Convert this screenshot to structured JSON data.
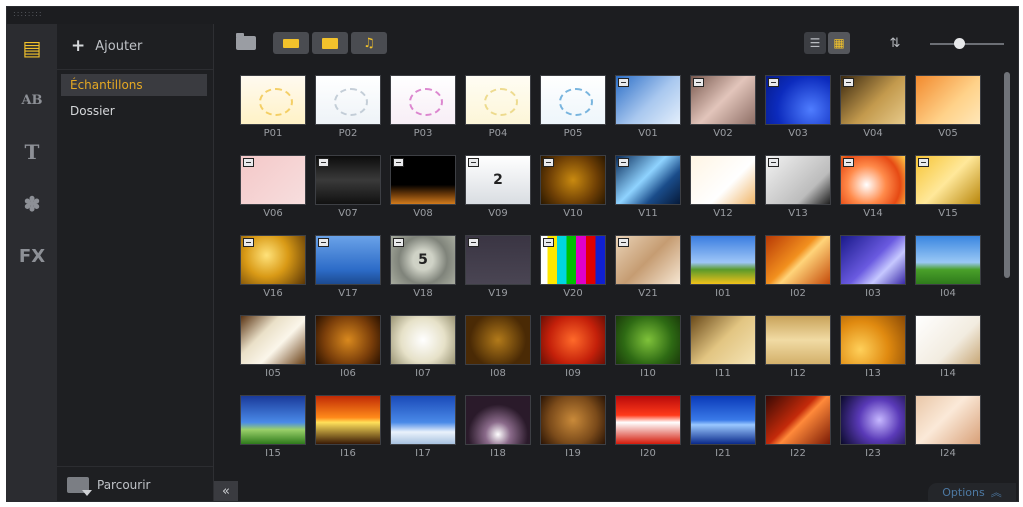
{
  "window": {
    "grip": "::::::::"
  },
  "rail": [
    {
      "name": "media-library-icon",
      "glyph": "▤"
    },
    {
      "name": "transition-icon",
      "glyph": "AB"
    },
    {
      "name": "title-icon",
      "glyph": "T"
    },
    {
      "name": "graphics-icon",
      "glyph": "✽"
    },
    {
      "name": "filter-icon",
      "glyph": "FX"
    }
  ],
  "library": {
    "add_label": "Ajouter",
    "items": [
      {
        "label": "Échantillons",
        "selected": true
      },
      {
        "label": "Dossier",
        "selected": false
      }
    ],
    "browse_label": "Parcourir"
  },
  "toolbar": {
    "view_list_glyph": "☰",
    "view_grid_glyph": "▦",
    "sort_glyph": "⇅",
    "collapse_glyph": "«",
    "options_label": "Options",
    "options_glyph": "︽"
  },
  "zoom": {
    "level": 0.4
  },
  "media": [
    {
      "label": "P01",
      "bg": "linear-gradient(#fffaf0,#fff2c6)",
      "fg": "#f2c64a",
      "badge": false
    },
    {
      "label": "P02",
      "bg": "linear-gradient(#ffffff,#eef3f7)",
      "fg": "#b8c4cf",
      "badge": false
    },
    {
      "label": "P03",
      "bg": "linear-gradient(#ffffff,#f7eef6)",
      "fg": "#d56cc5",
      "badge": false
    },
    {
      "label": "P04",
      "bg": "linear-gradient(#fffdf4,#fdf6d8)",
      "fg": "#ead47a",
      "badge": false
    },
    {
      "label": "P05",
      "bg": "linear-gradient(#ffffff,#eef6fb)",
      "fg": "#5aa4d7",
      "badge": false
    },
    {
      "label": "V01",
      "bg": "linear-gradient(135deg,#2d6fc7,#a9c8ef 55%,#e3eefb)",
      "badge": true
    },
    {
      "label": "V02",
      "bg": "linear-gradient(135deg,#7a5a50,#e2c5bb 50%,#8e6f66)",
      "badge": true
    },
    {
      "label": "V03",
      "bg": "radial-gradient(circle at 70% 70%,#4f7dff,#0c2bbd 60%,#061b8a)",
      "badge": true
    },
    {
      "label": "V04",
      "bg": "linear-gradient(135deg,#3c2a10,#c39a4d 55%,#e6c98a)",
      "badge": true
    },
    {
      "label": "V05",
      "bg": "linear-gradient(135deg,#f28a2e,#ffd28a 60%,#ffe7b8)",
      "badge": false
    },
    {
      "label": "V06",
      "bg": "linear-gradient(135deg,#f4c8c8,#f7dede)",
      "badge": true
    },
    {
      "label": "V07",
      "bg": "linear-gradient(#0c0c0c,#3a3a3a 50%,#111)",
      "badge": true
    },
    {
      "label": "V08",
      "bg": "linear-gradient(#000 60%,#6b3a0a 80%,#d27b1c)",
      "badge": true
    },
    {
      "label": "V09",
      "bg": "linear-gradient(#ffffff,#d9dde2)",
      "badge": true,
      "text": "2"
    },
    {
      "label": "V10",
      "bg": "radial-gradient(circle,#c98a10,#6e3f05 60%,#2a1800)",
      "badge": true
    },
    {
      "label": "V11",
      "bg": "linear-gradient(135deg,#0a2c5a,#8fd3ff 45%,#1a4c8a 70%,#061a3a)",
      "badge": true
    },
    {
      "label": "V12",
      "bg": "linear-gradient(135deg,#fff5e4,#ffffff 60%,#f0b66a)",
      "badge": false
    },
    {
      "label": "V13",
      "bg": "linear-gradient(135deg,#f2f2f2,#bcbcbc 70%,#1e1e1e)",
      "badge": true
    },
    {
      "label": "V14",
      "bg": "radial-gradient(circle at 40% 60%,#ffffff,#ff8a4a 40%,#e64a14 70%,#ffd04a)",
      "badge": true
    },
    {
      "label": "V15",
      "bg": "linear-gradient(135deg,#f7c436,#ffe89a 50%,#b8860b)",
      "badge": true
    },
    {
      "label": "V16",
      "bg": "radial-gradient(circle at 40% 40%,#ffe27a,#d99a16 45%,#5a3606)",
      "badge": true
    },
    {
      "label": "V17",
      "bg": "linear-gradient(#6aa2e8,#2d6cc8 70%,#1c4a90)",
      "badge": true
    },
    {
      "label": "V18",
      "bg": "radial-gradient(circle,#cfd2c6 25%,#7f837a 60%,#a8ac9f)",
      "badge": true,
      "text": "5"
    },
    {
      "label": "V19",
      "bg": "linear-gradient(#3a3543,#4a4553)",
      "badge": true
    },
    {
      "label": "V20",
      "bg": "linear-gradient(90deg,#ffffff 10%,#ffe700 10%,#ffe700 25%,#00d6e0 25%,#00d6e0 40%,#00c000 40%,#00c000 55%,#e000c8 55%,#e000c8 70%,#e00000 70%,#e00000 85%,#1020d0 85%)",
      "badge": true
    },
    {
      "label": "V21",
      "bg": "linear-gradient(135deg,#e9d2b6,#c59c72 50%,#f6e6d2)",
      "badge": true
    },
    {
      "label": "I01",
      "bg": "linear-gradient(#3a7de0,#9ec6f7 55%,#5a9a2a 70%,#f2c21a)",
      "badge": false
    },
    {
      "label": "I02",
      "bg": "linear-gradient(135deg,#b83a06,#f2901e 45%,#ffd47a 55%,#c44a0a)",
      "badge": false
    },
    {
      "label": "I03",
      "bg": "linear-gradient(135deg,#1a1a8a,#6a5ae0 50%,#c6c8ff 70%,#3a2aa8)",
      "badge": false
    },
    {
      "label": "I04",
      "bg": "linear-gradient(#3a86e0,#9ac8f5 55%,#4aa02a 70%,#2e7a1c)",
      "badge": false
    },
    {
      "label": "I05",
      "bg": "linear-gradient(135deg,#5a3414,#eae0c8 35%,#fbf6ea 60%,#6b4218)",
      "badge": false
    },
    {
      "label": "I06",
      "bg": "radial-gradient(circle,#d9891e,#7a3e0a 60%,#2a1200)",
      "badge": false
    },
    {
      "label": "I07",
      "bg": "radial-gradient(circle,#ffffff,#e6e1c8 55%,#9a9474)",
      "badge": false
    },
    {
      "label": "I08",
      "bg": "radial-gradient(circle,#b27a1a,#4a2a05 70%)",
      "badge": false
    },
    {
      "label": "I09",
      "bg": "radial-gradient(circle,#ff6a2a,#c4200a 60%,#6a0f05)",
      "badge": false
    },
    {
      "label": "I10",
      "bg": "radial-gradient(circle,#7fc23a,#2e6a14 60%,#1a3a0a)",
      "badge": false
    },
    {
      "label": "I11",
      "bg": "linear-gradient(135deg,#6a4a1a,#e2c582 50%,#f5e4b5)",
      "badge": false
    },
    {
      "label": "I12",
      "bg": "linear-gradient(#c9a35a,#f1dba4 50%,#d3b06a)",
      "badge": false
    },
    {
      "label": "I13",
      "bg": "radial-gradient(circle at 30% 70%,#ffd05a,#e08a10 50%,#8a4a05)",
      "badge": false
    },
    {
      "label": "I14",
      "bg": "linear-gradient(135deg,#ffffff,#f2ece0 60%,#c8a878)",
      "badge": false
    },
    {
      "label": "I15",
      "bg": "linear-gradient(#1a3a9a,#4a8ae8 55%,#9ad06a 70%,#2e7a1c)",
      "badge": false
    },
    {
      "label": "I16",
      "bg": "linear-gradient(#c02a05,#ff8a1a 45%,#ffe05a 55%,#3a1a05)",
      "badge": false
    },
    {
      "label": "I17",
      "bg": "linear-gradient(#1a4ab8,#4a8ae8 55%,#eaf2fb 75%,#a8c2e0)",
      "badge": false
    },
    {
      "label": "I18",
      "bg": "radial-gradient(circle at 50% 80%,#ffffff,#8a6a8a 25%,#2a1a2a 60%)",
      "badge": false
    },
    {
      "label": "I19",
      "bg": "radial-gradient(circle,#c98a3a,#7a4a1a 60%,#2a1405)",
      "badge": false
    },
    {
      "label": "I20",
      "bg": "linear-gradient(#b80a0a,#ff3a1a 40%,#ffffff 55%,#d41a0a)",
      "badge": false
    },
    {
      "label": "I21",
      "bg": "linear-gradient(#0a3ab8,#3a7ae8 50%,#9ac8ff 60%,#0a2a8a)",
      "badge": false
    },
    {
      "label": "I22",
      "bg": "linear-gradient(135deg,#3a0a05,#c42a0a 45%,#ff8a3a 55%,#7a1a05)",
      "badge": false
    },
    {
      "label": "I23",
      "bg": "radial-gradient(circle at 60% 50%,#c6b8ff,#5a3ab8 45%,#0a0a2a)",
      "badge": false
    },
    {
      "label": "I24",
      "bg": "linear-gradient(135deg,#e9c7a8,#fbe9d8 45%,#d8a078)",
      "badge": false
    }
  ]
}
